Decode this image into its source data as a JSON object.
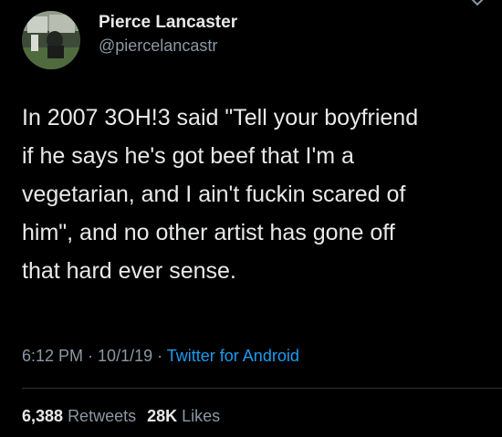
{
  "tweet": {
    "display_name": "Pierce Lancaster",
    "handle": "@piercelancastr",
    "text": "In 2007 3OH!3 said \"Tell your boyfriend\nif he says he's got beef that I'm a\nvegetarian, and I ain't fuckin scared of\nhim\", and no other artist has gone off\nthat hard ever sense.",
    "time": "6:12 PM",
    "date": "10/1/19",
    "separator": " · ",
    "source": "Twitter for Android",
    "retweets_count": "6,388",
    "retweets_label": "Retweets",
    "likes_count": "28K",
    "likes_label": "Likes",
    "avatar_icon": "profile-photo",
    "more_icon": "chevron-down-icon"
  },
  "colors": {
    "background": "#000000",
    "text": "#e7e9ea",
    "secondary": "#8b98a5",
    "link": "#1d9bf0",
    "divider": "#2f3336"
  }
}
